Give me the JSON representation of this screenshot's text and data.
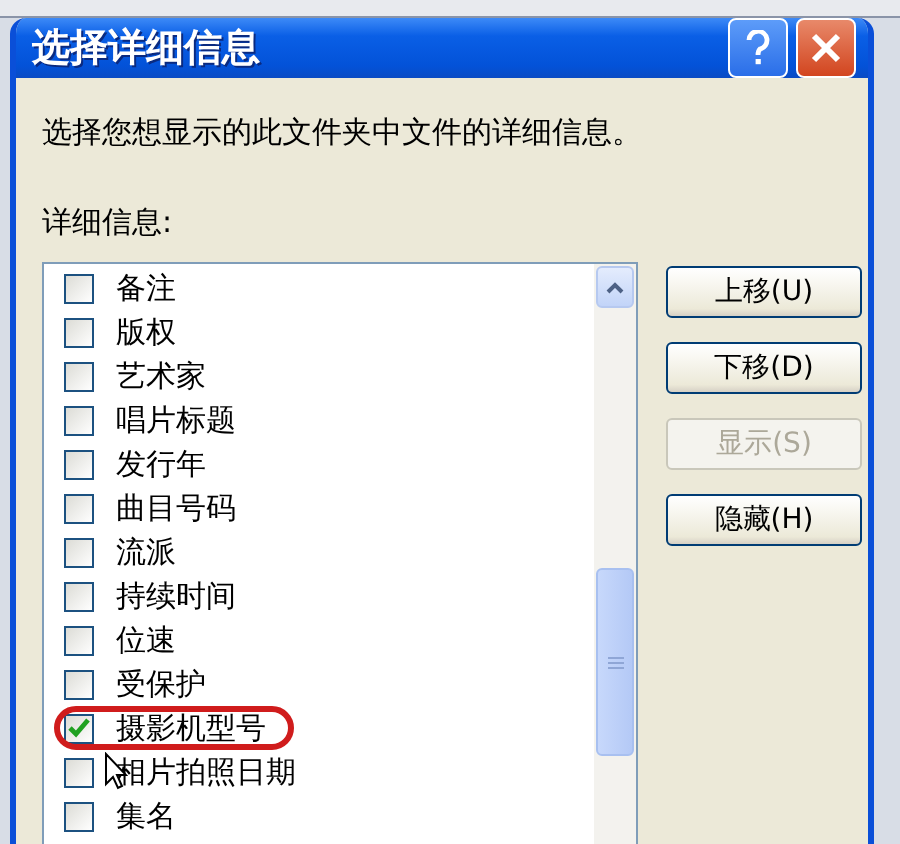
{
  "window": {
    "title": "选择详细信息"
  },
  "instruction": "选择您想显示的此文件夹中文件的详细信息。",
  "list_label": "详细信息:",
  "items": [
    {
      "label": "备注",
      "checked": false,
      "circled": false
    },
    {
      "label": "版权",
      "checked": false,
      "circled": false
    },
    {
      "label": "艺术家",
      "checked": false,
      "circled": false
    },
    {
      "label": "唱片标题",
      "checked": false,
      "circled": false
    },
    {
      "label": "发行年",
      "checked": false,
      "circled": false
    },
    {
      "label": "曲目号码",
      "checked": false,
      "circled": false
    },
    {
      "label": "流派",
      "checked": false,
      "circled": false
    },
    {
      "label": "持续时间",
      "checked": false,
      "circled": false
    },
    {
      "label": "位速",
      "checked": false,
      "circled": false
    },
    {
      "label": "受保护",
      "checked": false,
      "circled": false
    },
    {
      "label": "摄影机型号",
      "checked": true,
      "circled": true
    },
    {
      "label": "相片拍照日期",
      "checked": false,
      "circled": false
    },
    {
      "label": "集名",
      "checked": false,
      "circled": false
    }
  ],
  "buttons": [
    {
      "label": "上移(U)",
      "disabled": false
    },
    {
      "label": "下移(D)",
      "disabled": false
    },
    {
      "label": "显示(S)",
      "disabled": true
    },
    {
      "label": "隐藏(H)",
      "disabled": false
    }
  ]
}
